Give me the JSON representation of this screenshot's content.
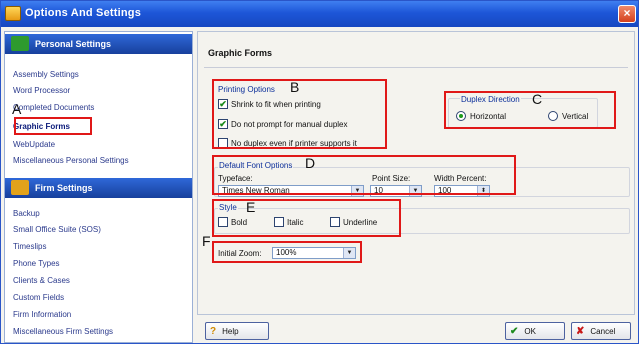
{
  "window": {
    "title": "Options And Settings",
    "close_glyph": "×"
  },
  "nav": {
    "personal": {
      "header": "Personal Settings",
      "items": [
        "Assembly Settings",
        "Word Processor",
        "Completed Documents",
        "Graphic Forms",
        "WebUpdate",
        "Miscellaneous Personal Settings"
      ]
    },
    "firm": {
      "header": "Firm Settings",
      "items": [
        "Backup",
        "Small Office Suite (SOS)",
        "Timeslips",
        "Phone Types",
        "Clients & Cases",
        "Custom Fields",
        "Firm Information",
        "Miscellaneous Firm Settings"
      ]
    }
  },
  "page": {
    "title": "Graphic Forms"
  },
  "printing": {
    "label": "Printing Options",
    "options": [
      {
        "label": "Shrink to fit when printing",
        "checked": true
      },
      {
        "label": "Do not prompt for manual duplex",
        "checked": true
      },
      {
        "label": "No duplex even if printer supports it",
        "checked": false
      }
    ]
  },
  "duplex": {
    "label": "Duplex Direction",
    "options": [
      {
        "label": "Horizontal",
        "selected": true
      },
      {
        "label": "Vertical",
        "selected": false
      }
    ]
  },
  "font": {
    "label": "Default Font Options",
    "typeface_label": "Typeface:",
    "typeface_value": "Times New Roman",
    "size_label": "Point Size:",
    "size_value": "10",
    "width_label": "Width Percent:",
    "width_value": "100"
  },
  "style": {
    "label": "Style",
    "options": [
      {
        "label": "Bold",
        "checked": false
      },
      {
        "label": "Italic",
        "checked": false
      },
      {
        "label": "Underline",
        "checked": false
      }
    ]
  },
  "zoom": {
    "label": "Initial Zoom:",
    "value": "100%"
  },
  "callouts": {
    "A": "A",
    "B": "B",
    "C": "C",
    "D": "D",
    "E": "E",
    "F": "F"
  },
  "buttons": {
    "help": "Help",
    "ok": "OK",
    "cancel": "Cancel"
  },
  "glyphs": {
    "check": "✔",
    "dropdown": "▼",
    "spin": "⬍",
    "help_icon": "?",
    "ok_icon": "✔",
    "cancel_icon": "✘"
  },
  "colors": {
    "title_bar": "#1d56d8",
    "nav_header": "#17409c",
    "annotation": "#e01818",
    "personal_icon": "#2e9a2e",
    "firm_icon": "#e2a21b"
  }
}
